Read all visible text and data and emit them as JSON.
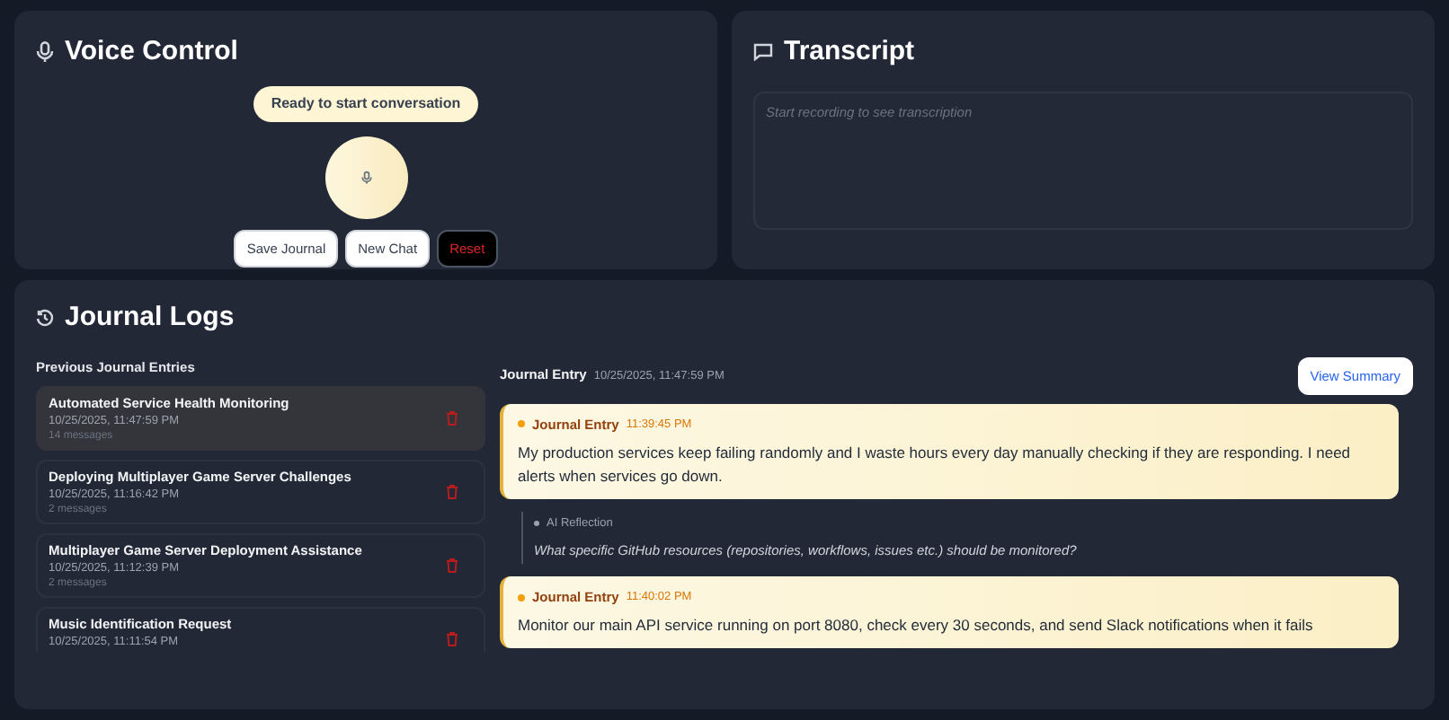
{
  "voice_control": {
    "title": "Voice Control",
    "status": "Ready to start conversation",
    "buttons": [
      {
        "label": "Save Journal",
        "kind": "light"
      },
      {
        "label": "New Chat",
        "kind": "light"
      },
      {
        "label": "Reset",
        "kind": "danger"
      }
    ]
  },
  "transcript": {
    "title": "Transcript",
    "placeholder": "Start recording to see transcription"
  },
  "journal_logs": {
    "title": "Journal Logs",
    "list_heading": "Previous Journal Entries",
    "entries": [
      {
        "title": "Automated Service Health Monitoring",
        "date": "10/25/2025, 11:47:59 PM",
        "count": "14 messages",
        "selected": true
      },
      {
        "title": "Deploying Multiplayer Game Server Challenges",
        "date": "10/25/2025, 11:16:42 PM",
        "count": "2 messages",
        "selected": false
      },
      {
        "title": "Multiplayer Game Server Deployment Assistance",
        "date": "10/25/2025, 11:12:39 PM",
        "count": "2 messages",
        "selected": false
      },
      {
        "title": "Music Identification Request",
        "date": "10/25/2025, 11:11:54 PM",
        "selected": false
      }
    ],
    "detail": {
      "heading": "Journal Entry",
      "date": "10/25/2025, 11:47:59 PM",
      "summary_button": "View Summary",
      "messages": [
        {
          "kind": "entry",
          "label": "Journal Entry",
          "time": "11:39:45 PM",
          "text": "My production services keep failing randomly and I waste hours every day manually checking if they are responding. I need alerts when services go down."
        },
        {
          "kind": "reflection",
          "label": "AI Reflection",
          "text": "What specific GitHub resources (repositories, workflows, issues etc.) should be monitored?"
        },
        {
          "kind": "entry",
          "label": "Journal Entry",
          "time": "11:40:02 PM",
          "text": "Monitor our main API service running on port 8080, check every 30 seconds, and send Slack notifications when it fails"
        }
      ]
    }
  }
}
